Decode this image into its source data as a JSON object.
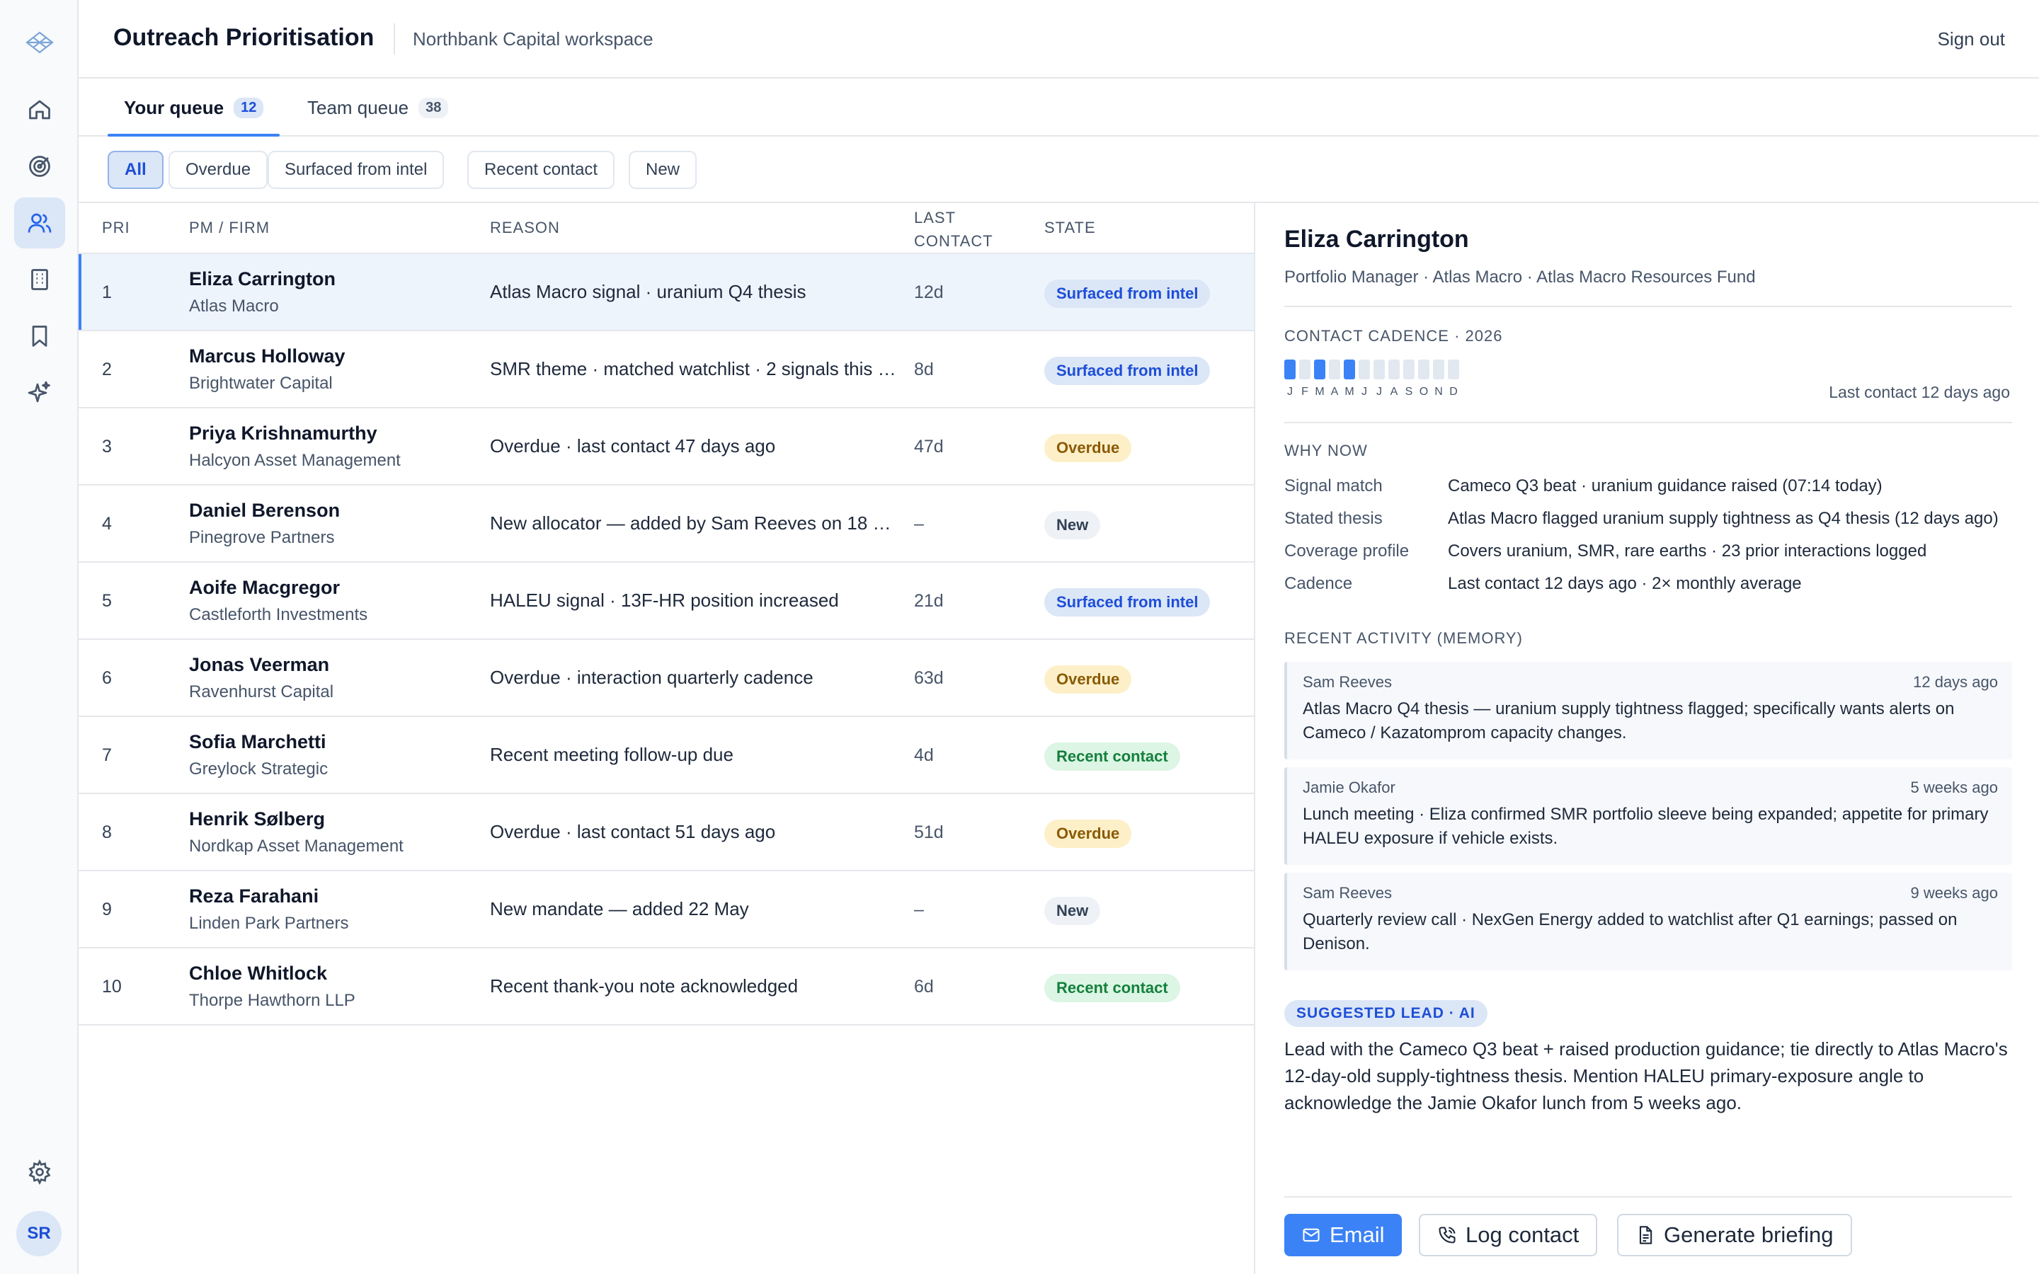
{
  "header": {
    "title": "Outreach Prioritisation",
    "workspace": "Northbank Capital workspace",
    "signout": "Sign out"
  },
  "user": {
    "initials": "SR"
  },
  "nav": {
    "icons": [
      "home-icon",
      "target-icon",
      "users-icon",
      "building-icon",
      "bookmark-icon",
      "sparkles-icon",
      "gear-icon"
    ],
    "active": "users-icon"
  },
  "tabs": [
    {
      "label": "Your queue",
      "count": "12"
    },
    {
      "label": "Team queue",
      "count": "38"
    }
  ],
  "filters": [
    "All",
    "Overdue",
    "Surfaced from intel",
    "Recent contact",
    "New"
  ],
  "table": {
    "columns": {
      "pri": "PRI",
      "pm": "PM / FIRM",
      "reason": "REASON",
      "last_contact": "LAST CONTACT",
      "state": "STATE"
    },
    "rows": [
      {
        "pri": "1",
        "name": "Eliza Carrington",
        "firm": "Atlas Macro",
        "reason": "Atlas Macro signal · uranium Q4 thesis",
        "last": "12d",
        "state": "Surfaced from intel",
        "kind": "intel"
      },
      {
        "pri": "2",
        "name": "Marcus Holloway",
        "firm": "Brightwater Capital",
        "reason": "SMR theme · matched watchlist · 2 signals this …",
        "last": "8d",
        "state": "Surfaced from intel",
        "kind": "intel"
      },
      {
        "pri": "3",
        "name": "Priya Krishnamurthy",
        "firm": "Halcyon Asset Management",
        "reason": "Overdue · last contact 47 days ago",
        "last": "47d",
        "state": "Overdue",
        "kind": "overdue"
      },
      {
        "pri": "4",
        "name": "Daniel Berenson",
        "firm": "Pinegrove Partners",
        "reason": "New allocator — added by Sam Reeves on 18 …",
        "last": "–",
        "state": "New",
        "kind": "new"
      },
      {
        "pri": "5",
        "name": "Aoife Macgregor",
        "firm": "Castleforth Investments",
        "reason": "HALEU signal · 13F-HR position increased",
        "last": "21d",
        "state": "Surfaced from intel",
        "kind": "intel"
      },
      {
        "pri": "6",
        "name": "Jonas Veerman",
        "firm": "Ravenhurst Capital",
        "reason": "Overdue · interaction quarterly cadence",
        "last": "63d",
        "state": "Overdue",
        "kind": "overdue"
      },
      {
        "pri": "7",
        "name": "Sofia Marchetti",
        "firm": "Greylock Strategic",
        "reason": "Recent meeting follow-up due",
        "last": "4d",
        "state": "Recent contact",
        "kind": "recent"
      },
      {
        "pri": "8",
        "name": "Henrik Sølberg",
        "firm": "Nordkap Asset Management",
        "reason": "Overdue · last contact 51 days ago",
        "last": "51d",
        "state": "Overdue",
        "kind": "overdue"
      },
      {
        "pri": "9",
        "name": "Reza Farahani",
        "firm": "Linden Park Partners",
        "reason": "New mandate — added 22 May",
        "last": "–",
        "state": "New",
        "kind": "new"
      },
      {
        "pri": "10",
        "name": "Chloe Whitlock",
        "firm": "Thorpe Hawthorn LLP",
        "reason": "Recent thank-you note acknowledged",
        "last": "6d",
        "state": "Recent contact",
        "kind": "recent"
      }
    ]
  },
  "detail": {
    "name": "Eliza Carrington",
    "role": "Portfolio Manager · Atlas Macro · Atlas Macro Resources Fund",
    "cadence": {
      "label": "CONTACT CADENCE · 2026",
      "months": [
        "J",
        "F",
        "M",
        "A",
        "M",
        "J",
        "J",
        "A",
        "S",
        "O",
        "N",
        "D"
      ],
      "contacted": [
        true,
        false,
        true,
        false,
        true,
        false,
        false,
        false,
        false,
        false,
        false,
        false
      ],
      "last_contact": "Last contact 12 days ago"
    },
    "why_now": {
      "label": "WHY NOW",
      "rows": [
        {
          "k": "Signal match",
          "v": "Cameco Q3 beat · uranium guidance raised (07:14 today)"
        },
        {
          "k": "Stated thesis",
          "v": "Atlas Macro flagged uranium supply tightness as Q4 thesis (12 days ago)"
        },
        {
          "k": "Coverage profile",
          "v": "Covers uranium, SMR, rare earths · 23 prior interactions logged"
        },
        {
          "k": "Cadence",
          "v": "Last contact 12 days ago · 2× monthly average"
        }
      ]
    },
    "activity": {
      "label": "RECENT ACTIVITY (MEMORY)",
      "items": [
        {
          "who": "Sam Reeves",
          "when": "12 days ago",
          "note": "Atlas Macro Q4 thesis — uranium supply tightness flagged; specifically wants alerts on Cameco / Kazatomprom capacity changes."
        },
        {
          "who": "Jamie Okafor",
          "when": "5 weeks ago",
          "note": "Lunch meeting · Eliza confirmed SMR portfolio sleeve being expanded; appetite for primary HALEU exposure if vehicle exists."
        },
        {
          "who": "Sam Reeves",
          "when": "9 weeks ago",
          "note": "Quarterly review call · NexGen Energy added to watchlist after Q1 earnings; passed on Denison."
        }
      ]
    },
    "suggested": {
      "badge": "SUGGESTED LEAD · AI",
      "text": "Lead with the Cameco Q3 beat + raised production guidance; tie directly to Atlas Macro's 12-day-old supply-tightness thesis. Mention HALEU primary-exposure angle to acknowledge the Jamie Okafor lunch from 5 weeks ago."
    },
    "actions": {
      "email": "Email",
      "log": "Log contact",
      "briefing": "Generate briefing"
    }
  },
  "colors": {
    "accent": "#3b82f6",
    "selected_row": "#eef4fc"
  }
}
